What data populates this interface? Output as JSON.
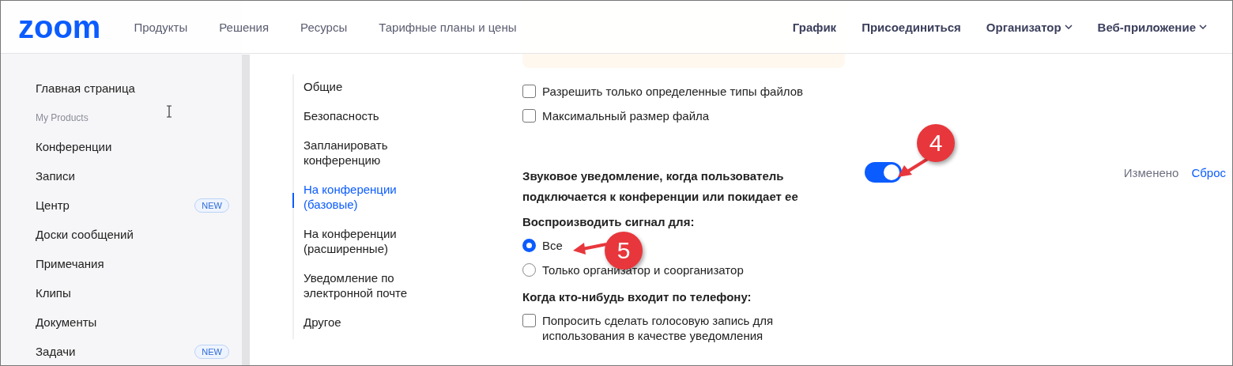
{
  "header": {
    "logo": "zoom",
    "nav_left": [
      "Продукты",
      "Решения",
      "Ресурсы",
      "Тарифные планы и цены"
    ],
    "nav_right": [
      {
        "label": "График",
        "dropdown": false
      },
      {
        "label": "Присоединиться",
        "dropdown": false
      },
      {
        "label": "Организатор",
        "dropdown": true
      },
      {
        "label": "Веб-приложение",
        "dropdown": true
      }
    ]
  },
  "sidebar": {
    "items": [
      {
        "kind": "link",
        "label": "Главная страница"
      },
      {
        "kind": "heading",
        "label": "My Products"
      },
      {
        "kind": "link",
        "label": "Конференции"
      },
      {
        "kind": "link",
        "label": "Записи"
      },
      {
        "kind": "link",
        "label": "Центр",
        "badge": "NEW"
      },
      {
        "kind": "link",
        "label": "Доски сообщений"
      },
      {
        "kind": "link",
        "label": "Примечания"
      },
      {
        "kind": "link",
        "label": "Клипы"
      },
      {
        "kind": "link",
        "label": "Документы"
      },
      {
        "kind": "link",
        "label": "Задачи",
        "badge": "NEW"
      }
    ]
  },
  "settings_nav": [
    {
      "label": "Общие",
      "selected": false
    },
    {
      "label": "Безопасность",
      "selected": false
    },
    {
      "label": "Запланировать конференцию",
      "selected": false
    },
    {
      "label": "На конференции (базовые)",
      "selected": true
    },
    {
      "label": "На конференции (расширенные)",
      "selected": false
    },
    {
      "label": "Уведомление по электронной почте",
      "selected": false
    },
    {
      "label": "Другое",
      "selected": false
    }
  ],
  "settings": [
    {
      "kind": "checkbox",
      "label": "Разрешить только определенные типы файлов",
      "checked": false
    },
    {
      "kind": "checkbox",
      "label": "Максимальный размер файла",
      "checked": false
    },
    {
      "kind": "toggle",
      "label": "Звуковое уведомление, когда пользователь подключается к конференции или покидает ее",
      "on": true,
      "status": "Изменено",
      "reset": "Сброс"
    },
    {
      "kind": "heading",
      "label": "Воспроизводить сигнал для:"
    },
    {
      "kind": "radio",
      "label": "Все",
      "selected": true
    },
    {
      "kind": "radio",
      "label": "Только организатор и соорганизатор",
      "selected": false
    },
    {
      "kind": "heading",
      "label": "Когда кто-нибудь входит по телефону:"
    },
    {
      "kind": "checkbox",
      "label": "Попросить сделать голосовую запись для использования в качестве уведомления",
      "checked": false
    }
  ],
  "callouts": [
    {
      "label": "4"
    },
    {
      "label": "5"
    }
  ]
}
